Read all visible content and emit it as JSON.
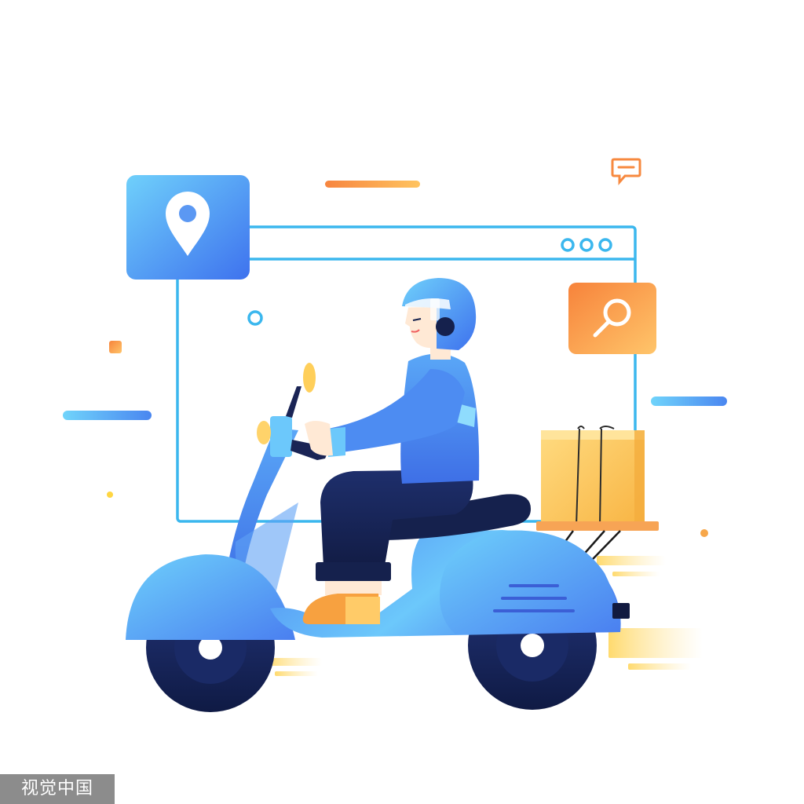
{
  "watermark": {
    "text": "视觉中国"
  },
  "colors": {
    "primary_blue": "#4e86f0",
    "light_blue": "#6fd0fb",
    "dark_navy": "#15214d",
    "orange": "#f7893f",
    "yellow": "#ffd36a",
    "browser_outline": "#3bb7ee"
  },
  "icons": {
    "location": "map-pin-icon",
    "search": "magnifier-icon",
    "chat": "speech-bubble-icon",
    "window_controls": "three-dot-icon"
  }
}
